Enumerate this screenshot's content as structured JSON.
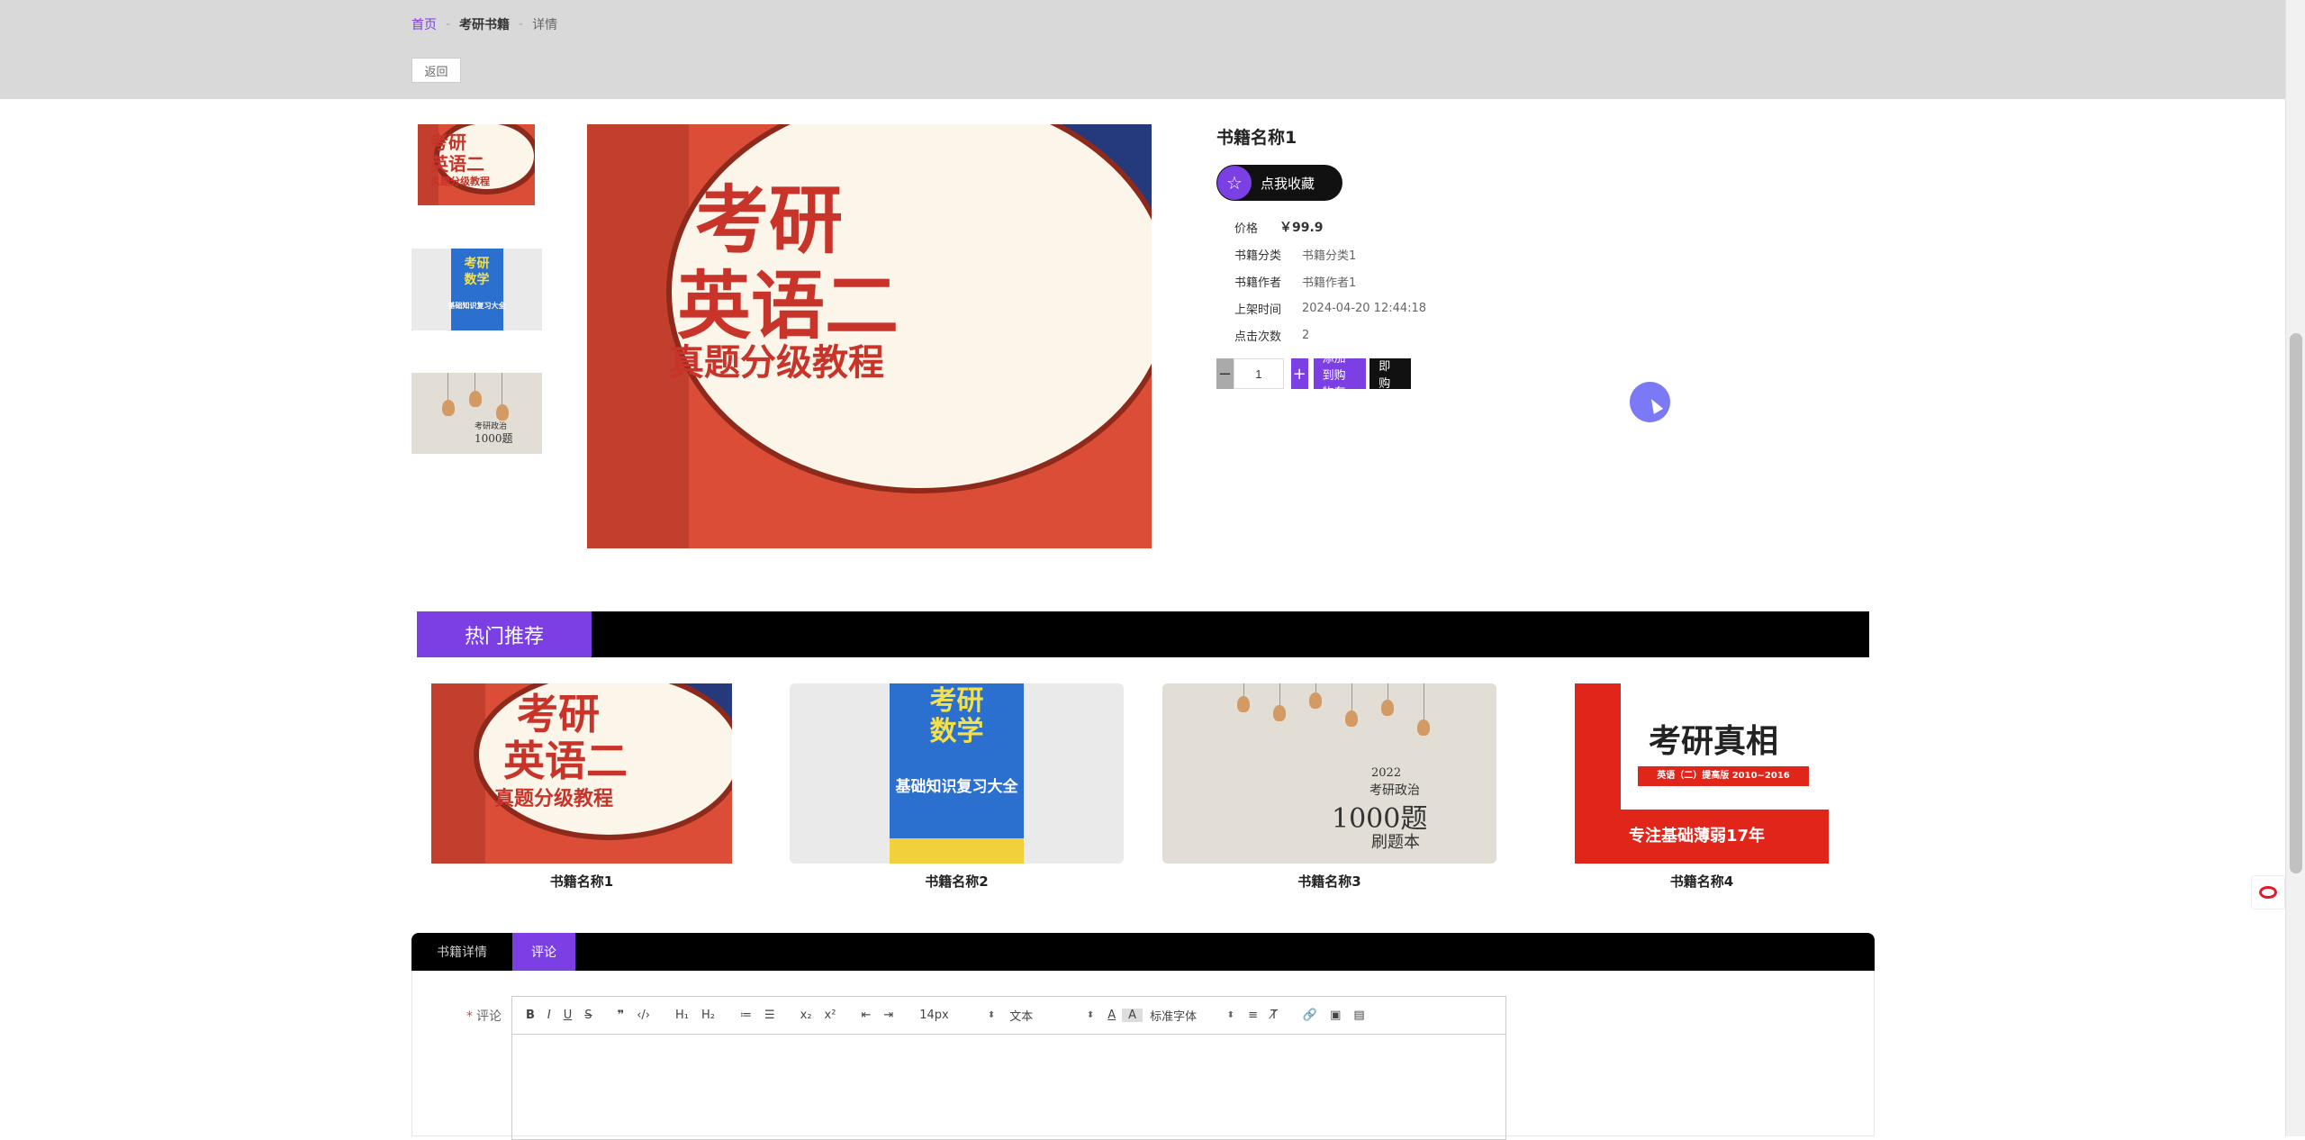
{
  "breadcrumb": {
    "home": "首页",
    "sep": "-",
    "category": "考研书籍",
    "current": "详情"
  },
  "back_label": "返回",
  "product": {
    "title": "书籍名称1",
    "favorite_label": "点我收藏",
    "price_key": "价格",
    "price_value": "￥99.9",
    "fields": [
      {
        "key": "书籍分类",
        "value": "书籍分类1"
      },
      {
        "key": "书籍作者",
        "value": "书籍作者1"
      },
      {
        "key": "上架时间",
        "value": "2024-04-20 12:44:18"
      },
      {
        "key": "点击次数",
        "value": "2"
      }
    ],
    "qty_minus": "−",
    "qty_plus": "+",
    "qty_value": "1",
    "add_cart_label": "添加到购物车",
    "buy_now_label": "立即购买"
  },
  "covers": {
    "english": {
      "line1": "考研",
      "line2": "英语二",
      "line3": "真题分级教程"
    },
    "math": {
      "line1": "考研",
      "line2": "数学",
      "line3": "基础知识复习大全"
    },
    "politics": {
      "line1": "2022",
      "line2": "考研政治",
      "line3": "1000题",
      "line4": "刷题本"
    },
    "truth": {
      "line1": "考研真相",
      "line2": "英语（二）提高版 2010~2016",
      "line3": "专注基础薄弱17年"
    }
  },
  "hot": {
    "title": "热门推荐",
    "items": [
      {
        "name": "书籍名称1"
      },
      {
        "name": "书籍名称2"
      },
      {
        "name": "书籍名称3"
      },
      {
        "name": "书籍名称4"
      }
    ]
  },
  "tabs": {
    "detail": "书籍详情",
    "comment": "评论"
  },
  "comment": {
    "required_mark": "*",
    "label": "评论",
    "toolbar": {
      "font_size": "14px",
      "text_style": "文本",
      "font_family": "标准字体"
    }
  },
  "colors": {
    "accent": "#7b3fe4",
    "topbar": "#d9d9d9",
    "dark": "#000000"
  }
}
